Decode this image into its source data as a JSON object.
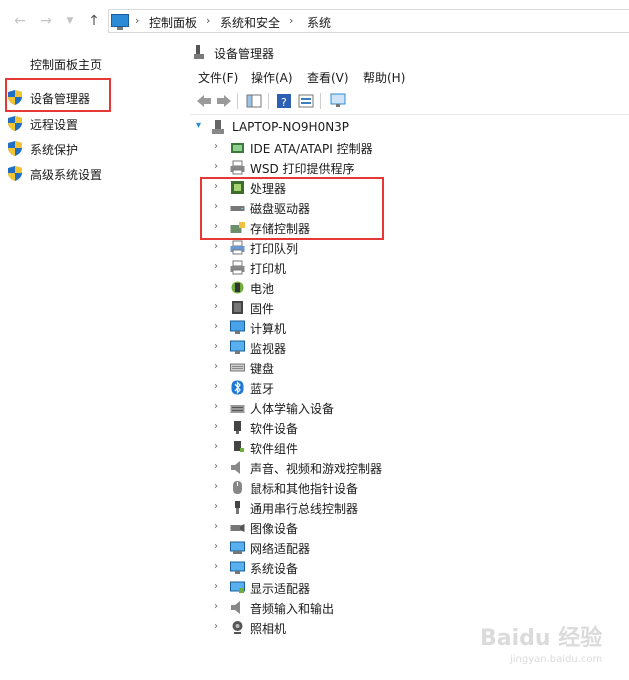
{
  "address": {
    "crumbs": [
      "控制面板",
      "系统和安全",
      "系统"
    ]
  },
  "left_panel": {
    "home": "控制面板主页",
    "items": [
      {
        "label": "设备管理器",
        "icon": "shield-icon"
      },
      {
        "label": "远程设置",
        "icon": "shield-icon"
      },
      {
        "label": "系统保护",
        "icon": "shield-icon"
      },
      {
        "label": "高级系统设置",
        "icon": "shield-icon"
      }
    ]
  },
  "device_manager": {
    "title": "设备管理器",
    "menu": [
      "文件(F)",
      "操作(A)",
      "查看(V)",
      "帮助(H)"
    ],
    "root": "LAPTOP-NO9H0N3P",
    "nodes": [
      {
        "label": "IDE ATA/ATAPI 控制器",
        "icon": "ide-controller-icon"
      },
      {
        "label": "WSD 打印提供程序",
        "icon": "printer-icon"
      },
      {
        "label": "处理器",
        "icon": "processor-icon"
      },
      {
        "label": "磁盘驱动器",
        "icon": "disk-drive-icon"
      },
      {
        "label": "存储控制器",
        "icon": "storage-controller-icon"
      },
      {
        "label": "打印队列",
        "icon": "print-queue-icon"
      },
      {
        "label": "打印机",
        "icon": "printer-icon"
      },
      {
        "label": "电池",
        "icon": "battery-icon"
      },
      {
        "label": "固件",
        "icon": "firmware-icon"
      },
      {
        "label": "计算机",
        "icon": "computer-icon"
      },
      {
        "label": "监视器",
        "icon": "monitor-icon"
      },
      {
        "label": "键盘",
        "icon": "keyboard-icon"
      },
      {
        "label": "蓝牙",
        "icon": "bluetooth-icon"
      },
      {
        "label": "人体学输入设备",
        "icon": "hid-icon"
      },
      {
        "label": "软件设备",
        "icon": "software-device-icon"
      },
      {
        "label": "软件组件",
        "icon": "software-component-icon"
      },
      {
        "label": "声音、视频和游戏控制器",
        "icon": "speaker-icon"
      },
      {
        "label": "鼠标和其他指针设备",
        "icon": "mouse-icon"
      },
      {
        "label": "通用串行总线控制器",
        "icon": "usb-icon"
      },
      {
        "label": "图像设备",
        "icon": "camera-icon"
      },
      {
        "label": "网络适配器",
        "icon": "network-adapter-icon"
      },
      {
        "label": "系统设备",
        "icon": "system-device-icon"
      },
      {
        "label": "显示适配器",
        "icon": "display-adapter-icon"
      },
      {
        "label": "音频输入和输出",
        "icon": "audio-io-icon"
      },
      {
        "label": "照相机",
        "icon": "webcam-icon"
      }
    ]
  },
  "watermark": {
    "line1": "Baidu 经验",
    "line2": "jingyan.baidu.com"
  },
  "colors": {
    "highlight_box": "#e53935",
    "accent": "#2b8bd6"
  }
}
